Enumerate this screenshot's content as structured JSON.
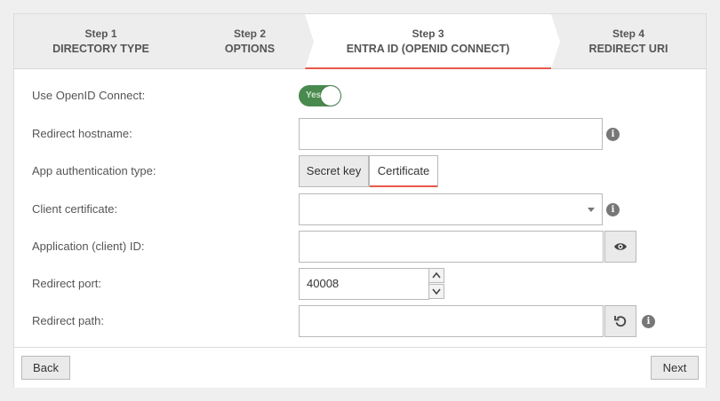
{
  "wizard": {
    "steps": [
      {
        "number": "Step 1",
        "title": "DIRECTORY TYPE"
      },
      {
        "number": "Step 2",
        "title": "OPTIONS"
      },
      {
        "number": "Step 3",
        "title": "ENTRA ID (OPENID CONNECT)",
        "active": true
      },
      {
        "number": "Step 4",
        "title": "REDIRECT URI"
      }
    ]
  },
  "form": {
    "use_openid": {
      "label": "Use OpenID Connect:",
      "toggle_text": "Yes",
      "value": true
    },
    "redirect_hostname": {
      "label": "Redirect hostname:",
      "value": ""
    },
    "auth_type": {
      "label": "App authentication type:",
      "options": [
        "Secret key",
        "Certificate"
      ],
      "selected": "Certificate"
    },
    "client_certificate": {
      "label": "Client certificate:",
      "value": ""
    },
    "client_id": {
      "label": "Application (client) ID:",
      "value": ""
    },
    "redirect_port": {
      "label": "Redirect port:",
      "value": "40008"
    },
    "redirect_path": {
      "label": "Redirect path:",
      "value": ""
    }
  },
  "icons": {
    "info": "i"
  },
  "footer": {
    "back_label": "Back",
    "next_label": "Next"
  },
  "colors": {
    "accent": "#e8584a",
    "toggle_on": "#4a8a4f"
  }
}
